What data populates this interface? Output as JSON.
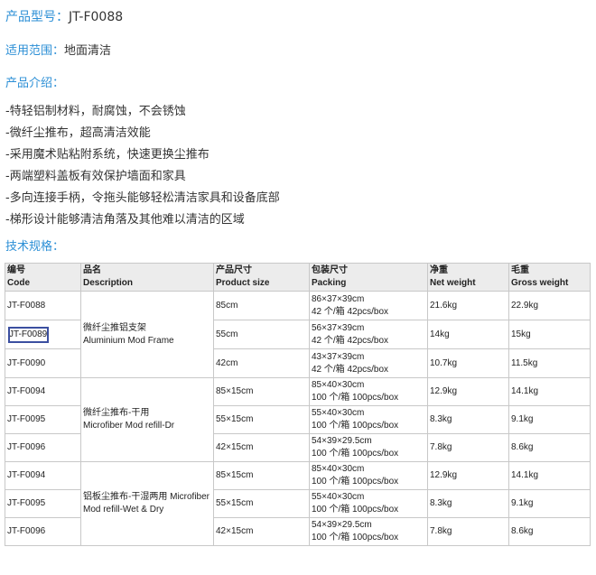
{
  "model": {
    "label": "产品型号：",
    "value": "JT-F0088"
  },
  "scope": {
    "label": "适用范围：",
    "value": "地面清洁"
  },
  "intro_heading": "产品介绍：",
  "features": [
    "-特轻铝制材料，耐腐蚀，不会锈蚀",
    "-微纤尘推布，超高清洁效能",
    "-采用魔术贴粘附系统，快速更换尘推布",
    "-两端塑料盖板有效保护墙面和家具",
    "-多向连接手柄，令拖头能够轻松清洁家具和设备底部",
    "-梯形设计能够清洁角落及其他难以清洁的区域"
  ],
  "spec_heading": "技术规格：",
  "table": {
    "headers": [
      {
        "cn": "编号",
        "en": "Code"
      },
      {
        "cn": "品名",
        "en": "Description"
      },
      {
        "cn": "产品尺寸",
        "en": "Product size"
      },
      {
        "cn": "包装尺寸",
        "en": "Packing"
      },
      {
        "cn": "净重",
        "en": "Net weight"
      },
      {
        "cn": "毛重",
        "en": "Gross weight"
      }
    ],
    "groups": [
      {
        "desc_cn": "微纤尘推铝支架",
        "desc_en": "Aluminium  Mod Frame"
      },
      {
        "desc_cn": "微纤尘推布-干用",
        "desc_en": "Microfiber Mod refill-Dr"
      },
      {
        "desc_cn": "铝板尘推布-干湿两用 Microfiber",
        "desc_en": "Mod refill-Wet & Dry"
      }
    ],
    "rows": [
      {
        "code": "JT-F0088",
        "size": "85cm",
        "pack_dim": "86×37×39cm",
        "pack_qty": "42 个/箱 42pcs/box",
        "net": "21.6kg",
        "gross": "22.9kg"
      },
      {
        "code": "JT-F0089",
        "size": "55cm",
        "pack_dim": "56×37×39cm",
        "pack_qty": "42 个/箱 42pcs/box",
        "net": "14kg",
        "gross": "15kg"
      },
      {
        "code": "JT-F0090",
        "size": "42cm",
        "pack_dim": "43×37×39cm",
        "pack_qty": "42 个/箱 42pcs/box",
        "net": "10.7kg",
        "gross": "11.5kg"
      },
      {
        "code": "JT-F0094",
        "size": "85×15cm",
        "pack_dim": "85×40×30cm",
        "pack_qty": "100 个/箱 100pcs/box",
        "net": "12.9kg",
        "gross": "14.1kg"
      },
      {
        "code": "JT-F0095",
        "size": "55×15cm",
        "pack_dim": "55×40×30cm",
        "pack_qty": "100 个/箱 100pcs/box",
        "net": "8.3kg",
        "gross": "9.1kg"
      },
      {
        "code": "JT-F0096",
        "size": "42×15cm",
        "pack_dim": "54×39×29.5cm",
        "pack_qty": "100 个/箱 100pcs/box",
        "net": "7.8kg",
        "gross": "8.6kg"
      },
      {
        "code": "JT-F0094",
        "size": "85×15cm",
        "pack_dim": "85×40×30cm",
        "pack_qty": "100 个/箱 100pcs/box",
        "net": "12.9kg",
        "gross": "14.1kg"
      },
      {
        "code": "JT-F0095",
        "size": "55×15cm",
        "pack_dim": "55×40×30cm",
        "pack_qty": "100 个/箱 100pcs/box",
        "net": "8.3kg",
        "gross": "9.1kg"
      },
      {
        "code": "JT-F0096",
        "size": "42×15cm",
        "pack_dim": "54×39×29.5cm",
        "pack_qty": "100 个/箱 100pcs/box",
        "net": "7.8kg",
        "gross": "8.6kg"
      }
    ]
  },
  "colors": {
    "accent": "#2c8fd6",
    "text": "#333333",
    "highlight_border": "#3b4fa0",
    "header_bg": "#ececec"
  }
}
